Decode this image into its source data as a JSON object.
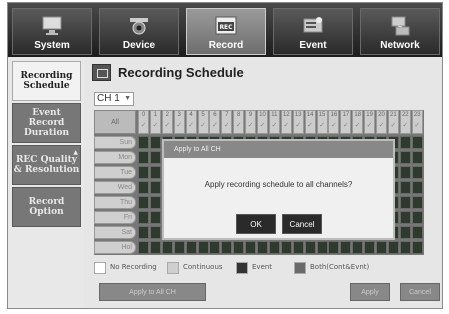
{
  "tabs": [
    {
      "label": "System",
      "icon": "monitor-icon"
    },
    {
      "label": "Device",
      "icon": "camera-icon"
    },
    {
      "label": "Record",
      "icon": "record-icon"
    },
    {
      "label": "Event",
      "icon": "event-icon"
    },
    {
      "label": "Network",
      "icon": "network-icon"
    }
  ],
  "active_tab": "Record",
  "sidebar": {
    "items": [
      {
        "label": "Recording Schedule"
      },
      {
        "label": "Event Record Duration"
      },
      {
        "label": "REC Quality & Resolution"
      },
      {
        "label": "Record Option"
      }
    ]
  },
  "page": {
    "title": "Recording Schedule"
  },
  "channel": {
    "selected": "CH 1"
  },
  "grid": {
    "all_label": "All",
    "hours": [
      "0",
      "1",
      "2",
      "3",
      "4",
      "5",
      "6",
      "7",
      "8",
      "9",
      "10",
      "11",
      "12",
      "13",
      "14",
      "15",
      "16",
      "17",
      "18",
      "19",
      "20",
      "21",
      "22",
      "23"
    ],
    "days": [
      "Sun",
      "Mon",
      "Tue",
      "Wed",
      "Thu",
      "Fri",
      "Sat",
      "Hol"
    ]
  },
  "legend": [
    {
      "label": "No Recording",
      "color": "#ffffff"
    },
    {
      "label": "Continuous",
      "color": "#cfcfcf"
    },
    {
      "label": "Event",
      "color": "#333333"
    },
    {
      "label": "Both(Cont&Evnt)",
      "color": "#6a6a6a"
    }
  ],
  "buttons": {
    "apply_all": "Apply to All CH",
    "apply": "Apply",
    "cancel": "Cancel"
  },
  "dialog": {
    "title": "Apply to All CH",
    "message": "Apply recording schedule to all channels?",
    "ok": "OK",
    "cancel": "Cancel"
  }
}
